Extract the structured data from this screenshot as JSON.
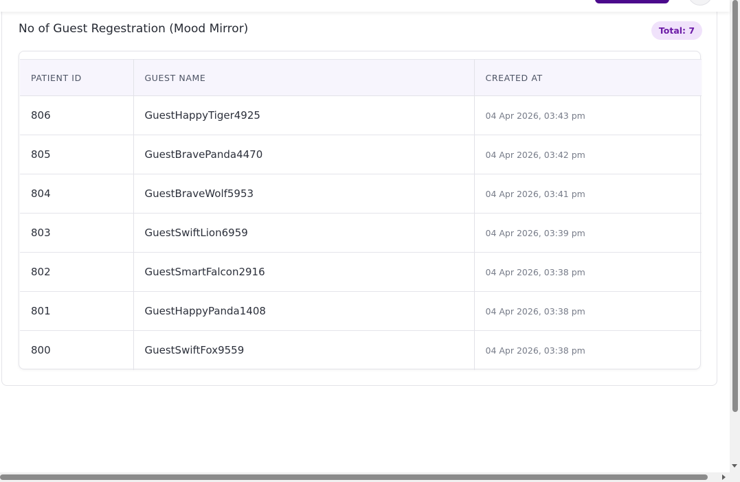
{
  "card": {
    "title": "No of Guest Regestration (Mood Mirror)",
    "total_badge": "Total: 7"
  },
  "table": {
    "headers": [
      "PATIENT ID",
      "GUEST NAME",
      "CREATED AT"
    ],
    "rows": [
      {
        "patient_id": "806",
        "guest_name": "GuestHappyTiger4925",
        "created_at": "04 Apr 2026, 03:43 pm"
      },
      {
        "patient_id": "805",
        "guest_name": "GuestBravePanda4470",
        "created_at": "04 Apr 2026, 03:42 pm"
      },
      {
        "patient_id": "804",
        "guest_name": "GuestBraveWolf5953",
        "created_at": "04 Apr 2026, 03:41 pm"
      },
      {
        "patient_id": "803",
        "guest_name": "GuestSwiftLion6959",
        "created_at": "04 Apr 2026, 03:39 pm"
      },
      {
        "patient_id": "802",
        "guest_name": "GuestSmartFalcon2916",
        "created_at": "04 Apr 2026, 03:38 pm"
      },
      {
        "patient_id": "801",
        "guest_name": "GuestHappyPanda1408",
        "created_at": "04 Apr 2026, 03:38 pm"
      },
      {
        "patient_id": "800",
        "guest_name": "GuestSwiftFox9559",
        "created_at": "04 Apr 2026, 03:38 pm"
      }
    ]
  },
  "colors": {
    "accent": "#4b0a8c",
    "badge_bg": "#f0e2fb",
    "badge_text": "#6b1aa6",
    "header_bg": "#f7f5fd"
  },
  "icons": {
    "scroll_down": "scroll-down-arrow-icon",
    "scroll_right": "scroll-right-arrow-icon"
  }
}
